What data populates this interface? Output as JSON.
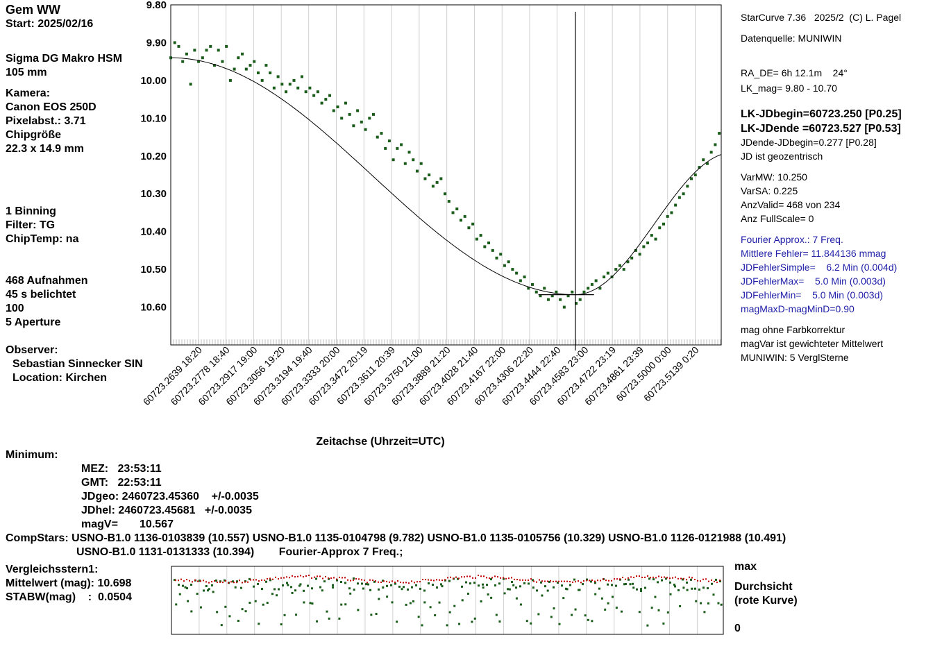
{
  "left": {
    "star": "Gem WW",
    "start": "Start: 2025/02/16",
    "lens": "Sigma DG Makro HSM",
    "focal": "105 mm",
    "kamera_label": "Kamera:",
    "camera": "Canon EOS 250D",
    "pixel": "Pixelabst.: 3.71",
    "chip_label": "Chipgröße",
    "chip_size": "22.3 x 14.9 mm",
    "binning": "1 Binning",
    "filter": "Filter: TG",
    "chiptemp": "ChipTemp: na",
    "frames": "468 Aufnahmen",
    "exposure": "45 s belichtet",
    "val100": "100",
    "aperture": "5 Aperture",
    "observer_label": "Observer:",
    "observer": "Sebastian Sinnecker SIN",
    "location": "Location: Kirchen"
  },
  "right": {
    "software": "StarCurve 7.36   2025/2  (C) L. Pagel",
    "source": "Datenquelle: MUNIWIN",
    "radec": "RA_DE= 6h 12.1m    24°",
    "lkmag": "LK_mag= 9.80 - 10.70",
    "jdbegin": "LK-JDbegin=60723.250 [P0.25]",
    "jdend": "LK-JDende =60723.527 [P0.53]",
    "jddiff": "JDende-JDbegin=0.277 [P0.28]",
    "geo": "JD ist geozentrisch",
    "varmw": "VarMW: 10.250",
    "varsa": "VarSA: 0.225",
    "anzvalid": "AnzValid= 468 von 234",
    "fullscale": "Anz FullScale= 0",
    "fourier": "Fourier Approx.: 7 Freq.",
    "fehler": "Mittlere Fehler= 11.844136 mmag",
    "jdfsimple": "JDFehlerSimple=    6.2 Min (0.004d)",
    "jdfmax": "JDFehlerMax=    5.0 Min (0.003d)",
    "jdfmin": "JDFehlerMin=    5.0 Min (0.003d)",
    "magdiff": "magMaxD-magMinD=0.90",
    "farb": "mag ohne Farbkorrektur",
    "magvar": "magVar ist gewichteter Mittelwert",
    "muniwin": "MUNIWIN: 5 VerglSterne"
  },
  "minimum": {
    "label": "Minimum:",
    "mez": "MEZ:   23:53:11",
    "gmt": "GMT:   22:53:11",
    "jdgeo": "JDgeo: 2460723.45360    +/-0.0035",
    "jdhel": "JDhel: 2460723.45681   +/-0.0035",
    "magv": "magV=       10.567"
  },
  "comp": {
    "line1": "CompStars: USNO-B1.0 1136-0103839 (10.557) USNO-B1.0 1135-0104798 (9.782) USNO-B1.0 1135-0105756 (10.329) USNO-B1.0 1126-0121988 (10.491)",
    "line2": "USNO-B1.0 1131-0131333 (10.394)        Fourier-Approx 7 Freq.;"
  },
  "vergleich": {
    "title": "Vergleichsstern1:",
    "mittel": "Mittelwert (mag): 10.698",
    "stabw": "STABW(mag)    :  0.0504",
    "max": "max",
    "durchsicht": "Durchsicht",
    "rote": "(rote Kurve)",
    "zero": "0"
  },
  "chart_data": {
    "type": "scatter",
    "xlabel": "Zeitachse (Uhrzeit=UTC)",
    "ylim": [
      9.8,
      10.7
    ],
    "y_inverted": true,
    "yticks": [
      "9.80",
      "9.90",
      "10.00",
      "10.10",
      "10.20",
      "10.30",
      "10.40",
      "10.50",
      "10.60"
    ],
    "xlim": [
      60723.25,
      60723.527
    ],
    "xticks": [
      {
        "jd": 60723.2639,
        "label": "60723.2639  18:20"
      },
      {
        "jd": 60723.2778,
        "label": "60723.2778  18:40"
      },
      {
        "jd": 60723.2917,
        "label": "60723.2917  19:00"
      },
      {
        "jd": 60723.3056,
        "label": "60723.3056  19:20"
      },
      {
        "jd": 60723.3194,
        "label": "60723.3194  19:40"
      },
      {
        "jd": 60723.3333,
        "label": "60723.3333  20:00"
      },
      {
        "jd": 60723.3472,
        "label": "60723.3472  20:19"
      },
      {
        "jd": 60723.3611,
        "label": "60723.3611  20:39"
      },
      {
        "jd": 60723.375,
        "label": "60723.3750  21:00"
      },
      {
        "jd": 60723.3889,
        "label": "60723.3889  21:20"
      },
      {
        "jd": 60723.4028,
        "label": "60723.4028  21:40"
      },
      {
        "jd": 60723.4167,
        "label": "60723.4167  22:00"
      },
      {
        "jd": 60723.4306,
        "label": "60723.4306  22:20"
      },
      {
        "jd": 60723.4444,
        "label": "60723.4444  22:40"
      },
      {
        "jd": 60723.4583,
        "label": "60723.4583  23:00"
      },
      {
        "jd": 60723.4722,
        "label": "60723.4722  23:19"
      },
      {
        "jd": 60723.4861,
        "label": "60723.4861  23:39"
      },
      {
        "jd": 60723.5,
        "label": "60723.5000  0:00"
      },
      {
        "jd": 60723.5139,
        "label": "60723.5139  0:20"
      }
    ],
    "minimum_jd": 60723.4536,
    "minimum_mag": 10.567,
    "minimum_bar": [
      60723.435,
      60723.463
    ],
    "series": [
      {
        "points": [
          [
            60723.25,
            9.94
          ],
          [
            60723.252,
            9.9
          ],
          [
            60723.254,
            9.91
          ],
          [
            60723.256,
            9.95
          ],
          [
            60723.258,
            9.93
          ],
          [
            60723.26,
            10.01
          ],
          [
            60723.262,
            9.92
          ],
          [
            60723.264,
            9.95
          ],
          [
            60723.266,
            9.94
          ],
          [
            60723.268,
            9.92
          ],
          [
            60723.27,
            9.91
          ],
          [
            60723.272,
            9.96
          ],
          [
            60723.274,
            9.92
          ],
          [
            60723.276,
            9.95
          ],
          [
            60723.278,
            9.91
          ],
          [
            60723.28,
            10.0
          ],
          [
            60723.282,
            9.97
          ],
          [
            60723.284,
            9.94
          ],
          [
            60723.286,
            9.93
          ],
          [
            60723.288,
            9.97
          ],
          [
            60723.29,
            9.96
          ],
          [
            60723.292,
            9.95
          ],
          [
            60723.294,
            9.98
          ],
          [
            60723.296,
            10.0
          ],
          [
            60723.298,
            9.96
          ],
          [
            60723.3,
            9.98
          ],
          [
            60723.302,
            10.02
          ],
          [
            60723.304,
            9.99
          ],
          [
            60723.306,
            10.01
          ],
          [
            60723.308,
            10.03
          ],
          [
            60723.31,
            10.01
          ],
          [
            60723.312,
            10.0
          ],
          [
            60723.314,
            10.02
          ],
          [
            60723.316,
            9.99
          ],
          [
            60723.318,
            10.03
          ],
          [
            60723.32,
            10.02
          ],
          [
            60723.322,
            10.04
          ],
          [
            60723.324,
            10.03
          ],
          [
            60723.326,
            10.06
          ],
          [
            60723.328,
            10.05
          ],
          [
            60723.33,
            10.04
          ],
          [
            60723.332,
            10.08
          ],
          [
            60723.334,
            10.07
          ],
          [
            60723.336,
            10.1
          ],
          [
            60723.338,
            10.06
          ],
          [
            60723.34,
            10.09
          ],
          [
            60723.342,
            10.12
          ],
          [
            60723.344,
            10.08
          ],
          [
            60723.346,
            10.11
          ],
          [
            60723.348,
            10.13
          ],
          [
            60723.35,
            10.1
          ],
          [
            60723.352,
            10.09
          ],
          [
            60723.354,
            10.15
          ],
          [
            60723.356,
            10.14
          ],
          [
            60723.358,
            10.18
          ],
          [
            60723.36,
            10.16
          ],
          [
            60723.362,
            10.21
          ],
          [
            60723.364,
            10.18
          ],
          [
            60723.366,
            10.17
          ],
          [
            60723.368,
            10.22
          ],
          [
            60723.37,
            10.19
          ],
          [
            60723.372,
            10.21
          ],
          [
            60723.374,
            10.24
          ],
          [
            60723.376,
            10.22
          ],
          [
            60723.378,
            10.26
          ],
          [
            60723.38,
            10.25
          ],
          [
            60723.382,
            10.28
          ],
          [
            60723.384,
            10.27
          ],
          [
            60723.386,
            10.26
          ],
          [
            60723.388,
            10.3
          ],
          [
            60723.39,
            10.32
          ],
          [
            60723.392,
            10.35
          ],
          [
            60723.394,
            10.34
          ],
          [
            60723.396,
            10.37
          ],
          [
            60723.398,
            10.36
          ],
          [
            60723.4,
            10.39
          ],
          [
            60723.402,
            10.38
          ],
          [
            60723.404,
            10.42
          ],
          [
            60723.406,
            10.41
          ],
          [
            60723.408,
            10.44
          ],
          [
            60723.41,
            10.43
          ],
          [
            60723.412,
            10.45
          ],
          [
            60723.414,
            10.47
          ],
          [
            60723.416,
            10.46
          ],
          [
            60723.418,
            10.49
          ],
          [
            60723.42,
            10.48
          ],
          [
            60723.422,
            10.5
          ],
          [
            60723.424,
            10.51
          ],
          [
            60723.426,
            10.53
          ],
          [
            60723.428,
            10.52
          ],
          [
            60723.43,
            10.55
          ],
          [
            60723.432,
            10.54
          ],
          [
            60723.434,
            10.56
          ],
          [
            60723.436,
            10.57
          ],
          [
            60723.438,
            10.55
          ],
          [
            60723.44,
            10.58
          ],
          [
            60723.442,
            10.57
          ],
          [
            60723.444,
            10.56
          ],
          [
            60723.446,
            10.58
          ],
          [
            60723.448,
            10.6
          ],
          [
            60723.45,
            10.57
          ],
          [
            60723.452,
            10.56
          ],
          [
            60723.454,
            10.59
          ],
          [
            60723.456,
            10.58
          ],
          [
            60723.458,
            10.56
          ],
          [
            60723.46,
            10.55
          ],
          [
            60723.462,
            10.54
          ],
          [
            60723.464,
            10.53
          ],
          [
            60723.466,
            10.55
          ],
          [
            60723.468,
            10.52
          ],
          [
            60723.47,
            10.51
          ],
          [
            60723.472,
            10.52
          ],
          [
            60723.474,
            10.5
          ],
          [
            60723.476,
            10.49
          ],
          [
            60723.478,
            10.5
          ],
          [
            60723.48,
            10.48
          ],
          [
            60723.482,
            10.47
          ],
          [
            60723.484,
            10.45
          ],
          [
            60723.486,
            10.46
          ],
          [
            60723.488,
            10.44
          ],
          [
            60723.49,
            10.43
          ],
          [
            60723.492,
            10.41
          ],
          [
            60723.494,
            10.42
          ],
          [
            60723.496,
            10.39
          ],
          [
            60723.498,
            10.38
          ],
          [
            60723.5,
            10.36
          ],
          [
            60723.502,
            10.35
          ],
          [
            60723.504,
            10.33
          ],
          [
            60723.506,
            10.31
          ],
          [
            60723.508,
            10.3
          ],
          [
            60723.51,
            10.28
          ],
          [
            60723.512,
            10.26
          ],
          [
            60723.514,
            10.25
          ],
          [
            60723.516,
            10.23
          ],
          [
            60723.518,
            10.21
          ],
          [
            60723.52,
            10.22
          ],
          [
            60723.522,
            10.19
          ],
          [
            60723.524,
            10.17
          ],
          [
            60723.526,
            10.14
          ]
        ]
      }
    ]
  }
}
